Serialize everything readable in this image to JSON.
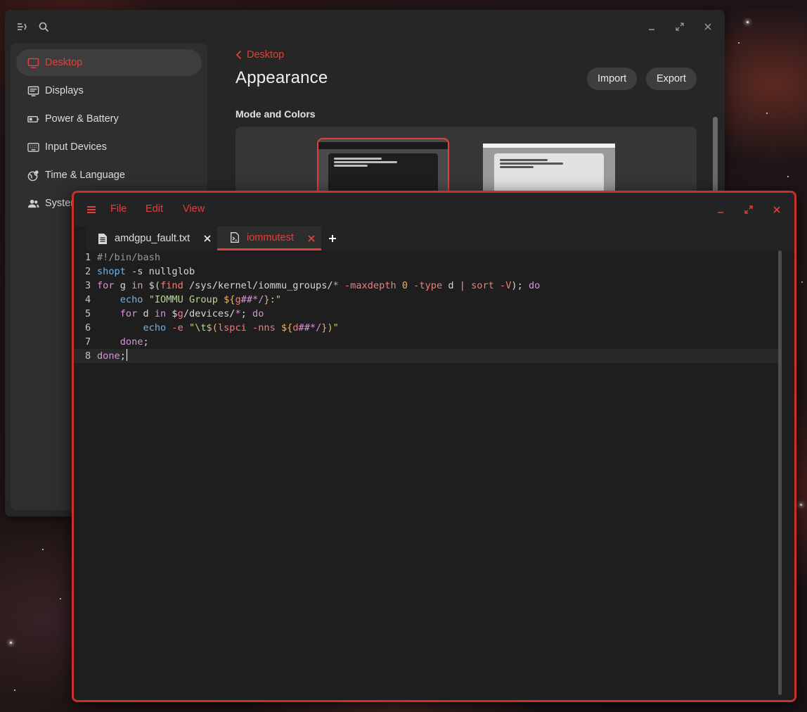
{
  "settings": {
    "sidebar": {
      "items": [
        {
          "label": "Desktop",
          "icon": "monitor-icon"
        },
        {
          "label": "Displays",
          "icon": "display-icon"
        },
        {
          "label": "Power & Battery",
          "icon": "battery-icon"
        },
        {
          "label": "Input Devices",
          "icon": "keyboard-icon"
        },
        {
          "label": "Time & Language",
          "icon": "globe-icon"
        },
        {
          "label": "System",
          "icon": "users-icon"
        }
      ],
      "active_index": 0
    },
    "breadcrumb": "Desktop",
    "title": "Appearance",
    "import_label": "Import",
    "export_label": "Export",
    "section_title": "Mode and Colors",
    "modes": [
      "dark",
      "light"
    ],
    "selected_mode": "dark"
  },
  "editor": {
    "menu": {
      "file": "File",
      "edit": "Edit",
      "view": "View"
    },
    "tabs": [
      {
        "label": "amdgpu_fault.txt",
        "icon": "text-file-icon",
        "active": false
      },
      {
        "label": "iommutest",
        "icon": "script-file-icon",
        "active": true
      }
    ],
    "code_lines": [
      {
        "no": "1",
        "html": "<span class=\"c\">#!/bin/bash</span>"
      },
      {
        "no": "2",
        "html": "<span class=\"b\">shopt</span> -s nullglob"
      },
      {
        "no": "3",
        "html": "<span class=\"k\">for</span> g <span class=\"k\">in</span> $(<span class=\"o\">find</span> /sys/kernel/iommu_groups/<span class=\"k\">*</span> <span class=\"o\">-maxdepth</span> <span class=\"n\">0</span> <span class=\"o\">-type</span> d <span class=\"k\">|</span> <span class=\"o\">sort</span> <span class=\"o\">-V</span>); <span class=\"k\">do</span>"
      },
      {
        "no": "4",
        "html": "    <span class=\"b\">echo</span> <span class=\"s\">\"IOMMU Group </span><span class=\"n\">${</span><span class=\"o\">g</span><span class=\"k\">##*/</span><span class=\"n\">}</span><span class=\"s\">:\"</span>"
      },
      {
        "no": "5",
        "html": "    <span class=\"k\">for</span> d <span class=\"k\">in</span> $<span class=\"o\">g</span>/devices/<span class=\"k\">*</span>; <span class=\"k\">do</span>"
      },
      {
        "no": "6",
        "html": "        <span class=\"b\">echo</span> <span class=\"o\">-e</span> <span class=\"s\">\"\\t</span><span class=\"n\">$(</span><span class=\"o\">lspci -nns</span> <span class=\"n\">${</span><span class=\"o\">d</span><span class=\"k\">##*/</span><span class=\"n\">})</span><span class=\"s\">\"</span>"
      },
      {
        "no": "7",
        "html": "    <span class=\"k\">done</span>;"
      },
      {
        "no": "8",
        "html": "<span class=\"k\">done</span>;",
        "current": true
      }
    ]
  },
  "colors": {
    "accent": "#e0413d",
    "window_border": "#c9302c"
  }
}
